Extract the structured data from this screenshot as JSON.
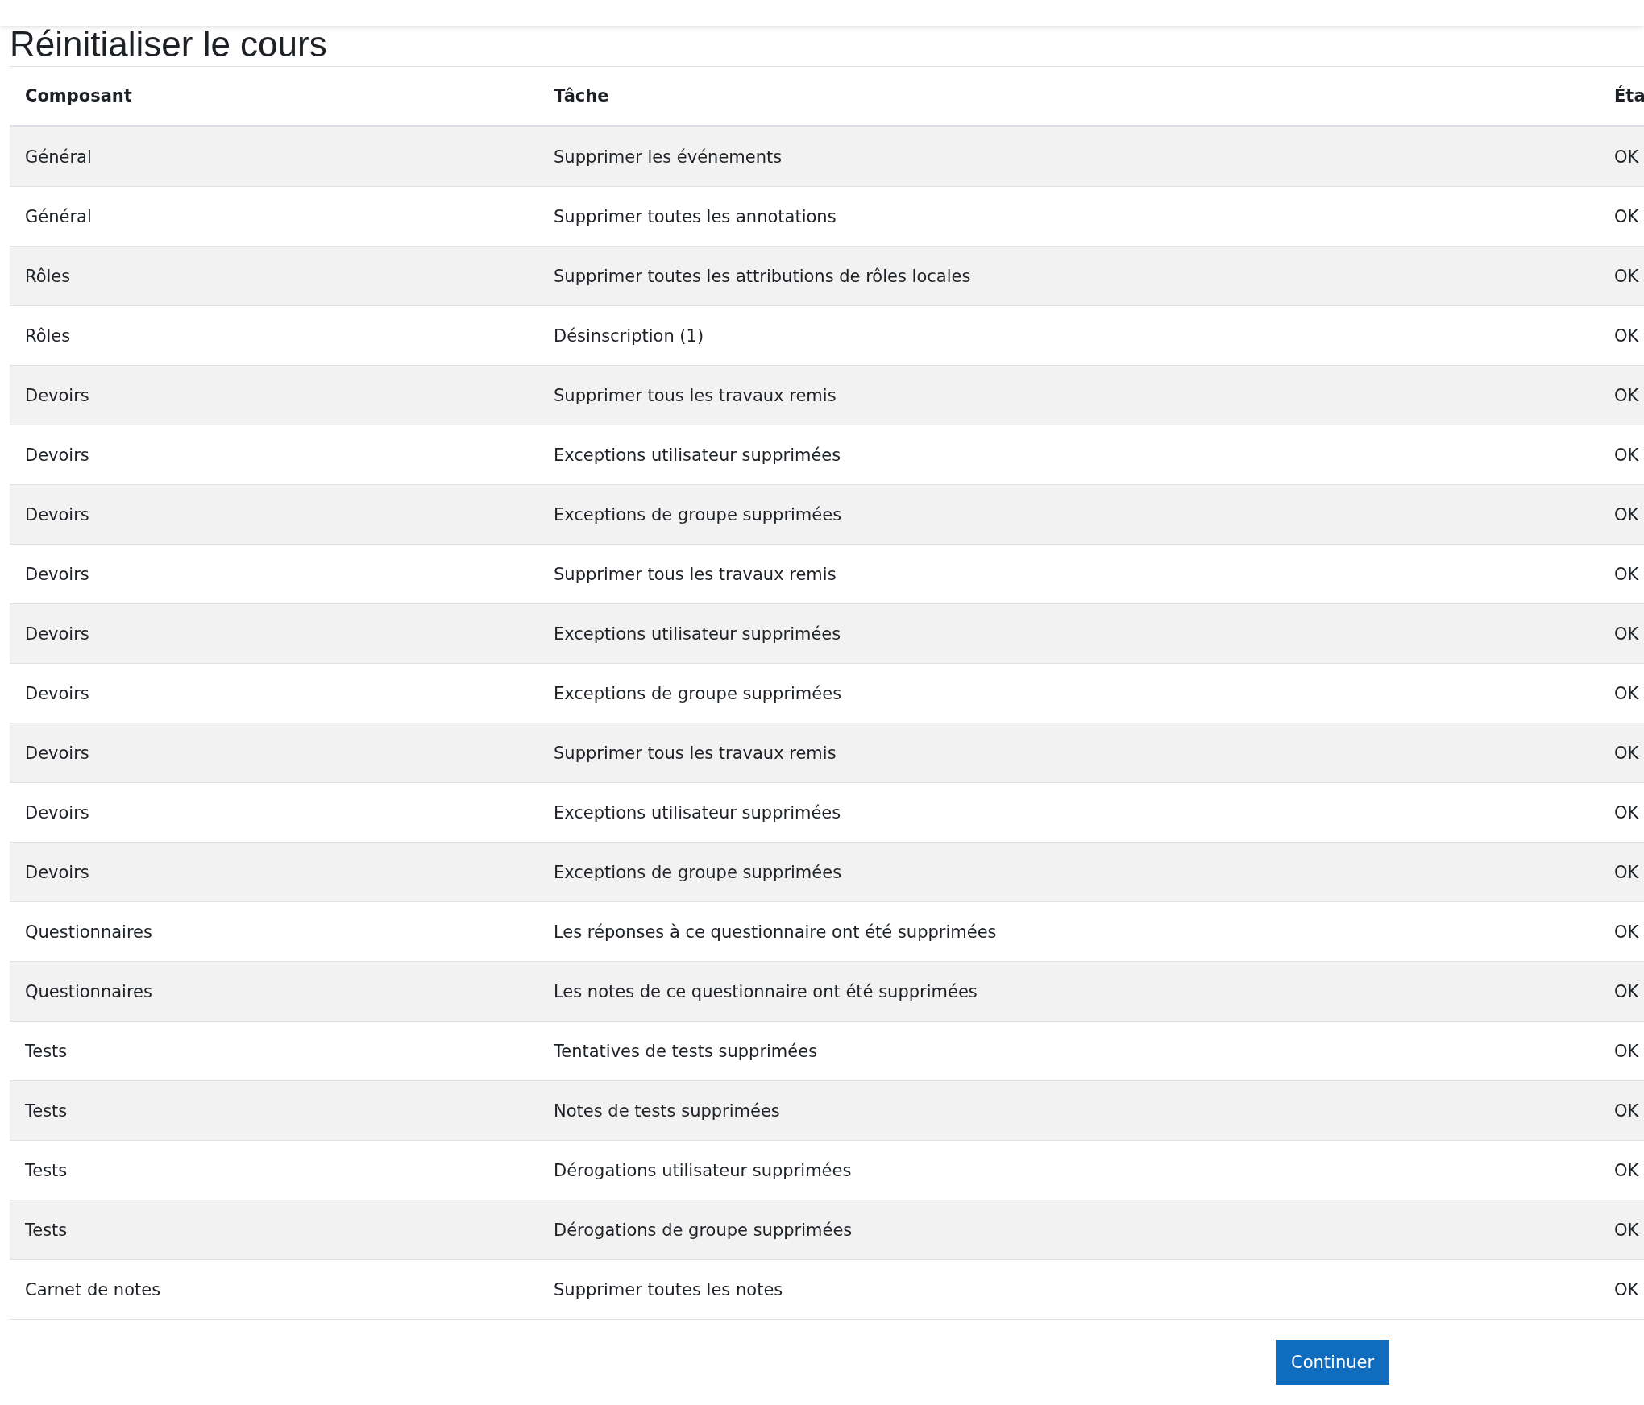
{
  "page_title": "Réinitialiser le cours",
  "table": {
    "columns": [
      "Composant",
      "Tâche",
      "Éta"
    ],
    "rows": [
      {
        "component": "Général",
        "task": "Supprimer les événements",
        "status": "OK"
      },
      {
        "component": "Général",
        "task": "Supprimer toutes les annotations",
        "status": "OK"
      },
      {
        "component": "Rôles",
        "task": "Supprimer toutes les attributions de rôles locales",
        "status": "OK"
      },
      {
        "component": "Rôles",
        "task": "Désinscription (1)",
        "status": "OK"
      },
      {
        "component": "Devoirs",
        "task": "Supprimer tous les travaux remis",
        "status": "OK"
      },
      {
        "component": "Devoirs",
        "task": "Exceptions utilisateur supprimées",
        "status": "OK"
      },
      {
        "component": "Devoirs",
        "task": "Exceptions de groupe supprimées",
        "status": "OK"
      },
      {
        "component": "Devoirs",
        "task": "Supprimer tous les travaux remis",
        "status": "OK"
      },
      {
        "component": "Devoirs",
        "task": "Exceptions utilisateur supprimées",
        "status": "OK"
      },
      {
        "component": "Devoirs",
        "task": "Exceptions de groupe supprimées",
        "status": "OK"
      },
      {
        "component": "Devoirs",
        "task": "Supprimer tous les travaux remis",
        "status": "OK"
      },
      {
        "component": "Devoirs",
        "task": "Exceptions utilisateur supprimées",
        "status": "OK"
      },
      {
        "component": "Devoirs",
        "task": "Exceptions de groupe supprimées",
        "status": "OK"
      },
      {
        "component": "Questionnaires",
        "task": "Les réponses à ce questionnaire ont été supprimées",
        "status": "OK"
      },
      {
        "component": "Questionnaires",
        "task": "Les notes de ce questionnaire ont été supprimées",
        "status": "OK"
      },
      {
        "component": "Tests",
        "task": "Tentatives de tests supprimées",
        "status": "OK"
      },
      {
        "component": "Tests",
        "task": "Notes de tests supprimées",
        "status": "OK"
      },
      {
        "component": "Tests",
        "task": "Dérogations utilisateur supprimées",
        "status": "OK"
      },
      {
        "component": "Tests",
        "task": "Dérogations de groupe supprimées",
        "status": "OK"
      },
      {
        "component": "Carnet de notes",
        "task": "Supprimer toutes les notes",
        "status": "OK"
      }
    ]
  },
  "continue_button": "Continuer"
}
